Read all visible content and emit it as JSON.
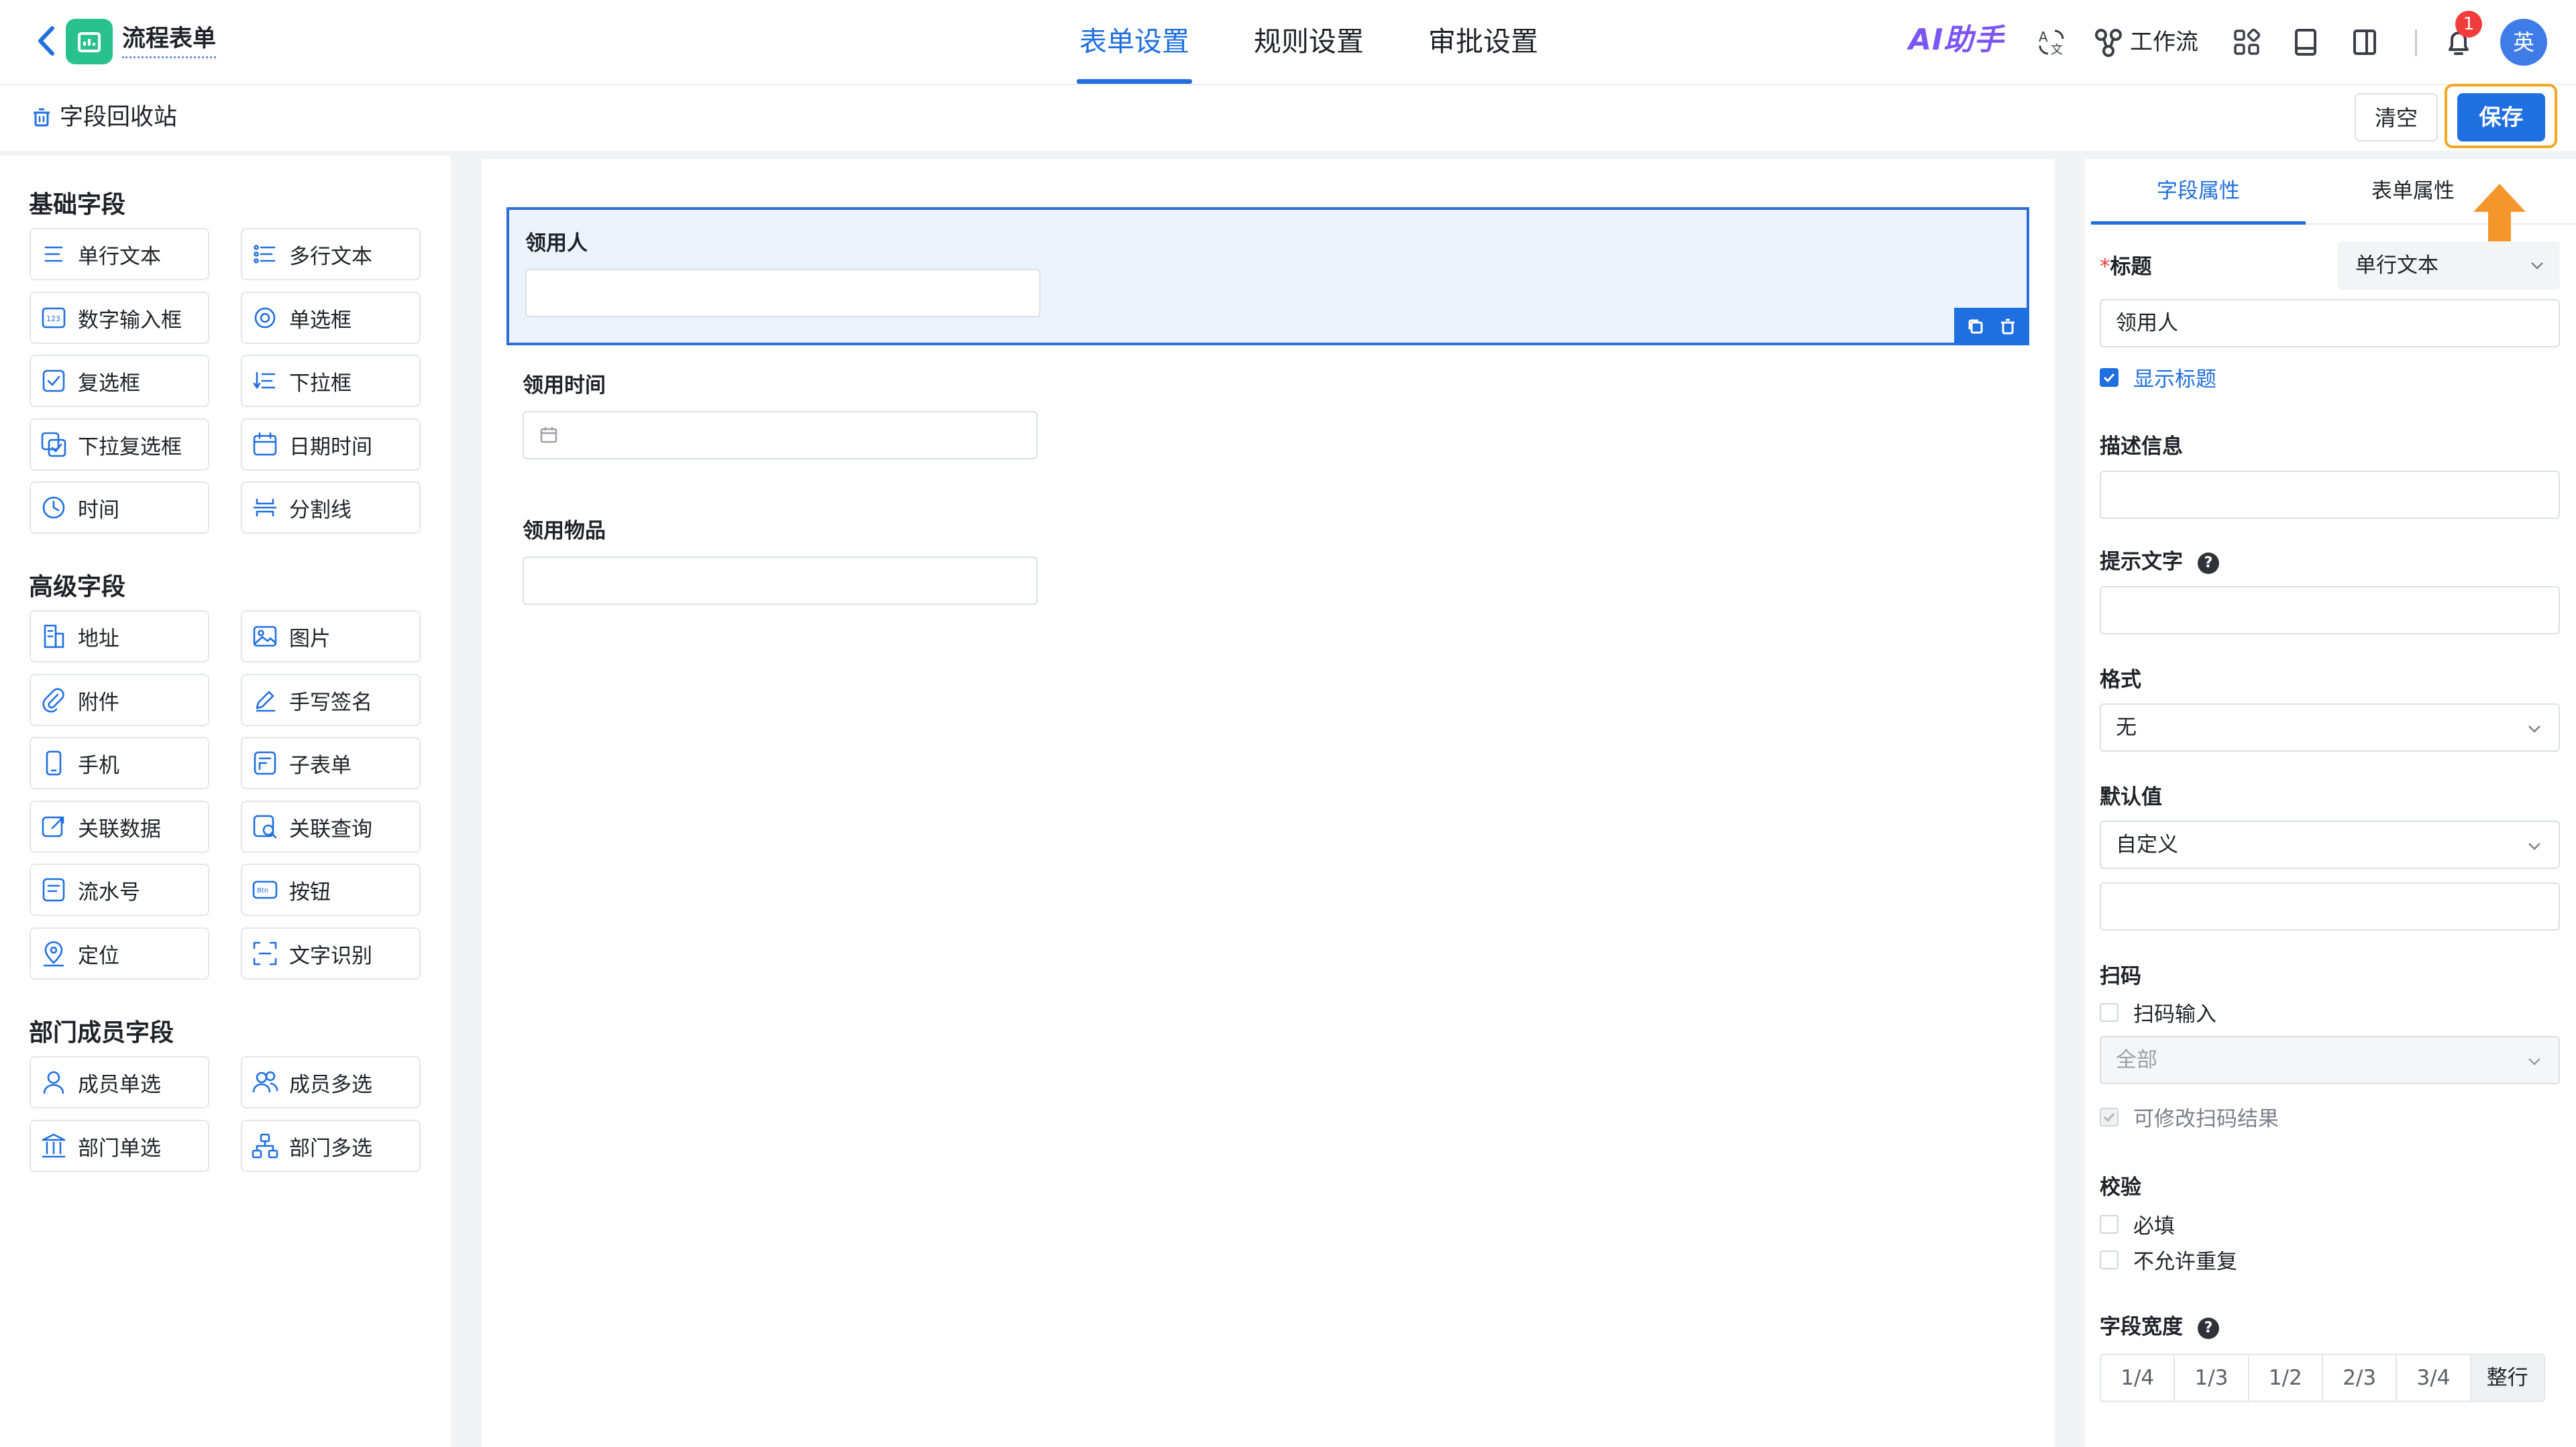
{
  "header": {
    "app_title": "流程表单",
    "tabs": [
      "表单设置",
      "规则设置",
      "审批设置"
    ],
    "active_tab": 0,
    "ai_helper": "AI助手",
    "workflow": "工作流",
    "notification_count": "1",
    "avatar_text": "英"
  },
  "toolbar": {
    "recycle_bin": "字段回收站",
    "clear_label": "清空",
    "save_label": "保存"
  },
  "palette": {
    "sections": [
      {
        "title": "基础字段",
        "items": [
          {
            "label": "单行文本",
            "icon": "single-line-text-icon"
          },
          {
            "label": "多行文本",
            "icon": "multi-line-text-icon"
          },
          {
            "label": "数字输入框",
            "icon": "number-input-icon"
          },
          {
            "label": "单选框",
            "icon": "radio-icon"
          },
          {
            "label": "复选框",
            "icon": "checkbox-icon"
          },
          {
            "label": "下拉框",
            "icon": "dropdown-icon"
          },
          {
            "label": "下拉复选框",
            "icon": "dropdown-checkbox-icon"
          },
          {
            "label": "日期时间",
            "icon": "calendar-icon"
          },
          {
            "label": "时间",
            "icon": "clock-icon"
          },
          {
            "label": "分割线",
            "icon": "divider-icon"
          }
        ]
      },
      {
        "title": "高级字段",
        "items": [
          {
            "label": "地址",
            "icon": "building-icon"
          },
          {
            "label": "图片",
            "icon": "image-icon"
          },
          {
            "label": "附件",
            "icon": "paperclip-icon"
          },
          {
            "label": "手写签名",
            "icon": "pen-icon"
          },
          {
            "label": "手机",
            "icon": "phone-icon"
          },
          {
            "label": "子表单",
            "icon": "subform-icon"
          },
          {
            "label": "关联数据",
            "icon": "link-data-icon"
          },
          {
            "label": "关联查询",
            "icon": "link-query-icon"
          },
          {
            "label": "流水号",
            "icon": "serial-number-icon"
          },
          {
            "label": "按钮",
            "icon": "button-icon"
          },
          {
            "label": "定位",
            "icon": "location-icon"
          },
          {
            "label": "文字识别",
            "icon": "ocr-icon"
          }
        ]
      },
      {
        "title": "部门成员字段",
        "items": [
          {
            "label": "成员单选",
            "icon": "user-icon"
          },
          {
            "label": "成员多选",
            "icon": "users-icon"
          },
          {
            "label": "部门单选",
            "icon": "department-icon"
          },
          {
            "label": "部门多选",
            "icon": "org-chart-icon"
          }
        ]
      }
    ]
  },
  "canvas": {
    "fields": [
      {
        "label": "领用人",
        "type": "text",
        "selected": true
      },
      {
        "label": "领用时间",
        "type": "date"
      },
      {
        "label": "领用物品",
        "type": "text"
      }
    ]
  },
  "properties": {
    "tabs": [
      "字段属性",
      "表单属性"
    ],
    "active_tab": 0,
    "title_label": "标题",
    "required_mark": "*",
    "field_type": "单行文本",
    "title_value": "领用人",
    "show_title": "显示标题",
    "description_label": "描述信息",
    "placeholder_label": "提示文字",
    "format_label": "格式",
    "format_value": "无",
    "default_label": "默认值",
    "default_value": "自定义",
    "scan_label": "扫码",
    "scan_input": "扫码输入",
    "scan_scope": "全部",
    "scan_editable": "可修改扫码结果",
    "validation_label": "校验",
    "required_check": "必填",
    "no_duplicate_check": "不允许重复",
    "width_label": "字段宽度",
    "width_options": [
      "1/4",
      "1/3",
      "1/2",
      "2/3",
      "3/4",
      "整行"
    ],
    "width_selected": 5,
    "help_glyph": "?"
  },
  "colors": {
    "primary": "#1f6fe0",
    "highlight": "#f5a623",
    "logo": "#29c28f",
    "ai": "#7c56f5"
  }
}
